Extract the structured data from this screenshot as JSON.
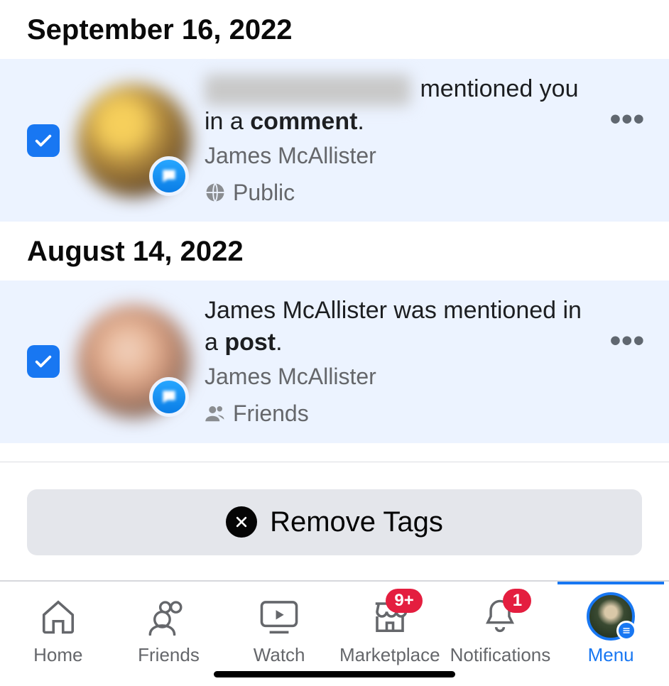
{
  "sections": [
    {
      "date": "September 16, 2022",
      "item": {
        "mentioner_blurred": true,
        "text_part1": " mentioned you in a ",
        "bold_word": "comment",
        "text_part2": ".",
        "sub": "James McAllister",
        "privacy": {
          "icon": "public",
          "label": "Public"
        },
        "checked": true
      }
    },
    {
      "date": "August 14, 2022",
      "item": {
        "mentioner_blurred": false,
        "line": "James McAllister was mentioned in a ",
        "bold_word": "post",
        "text_part2": ".",
        "sub": "James McAllister",
        "privacy": {
          "icon": "friends",
          "label": "Friends"
        },
        "checked": true
      }
    }
  ],
  "remove_tags_label": "Remove Tags",
  "nav": {
    "items": [
      {
        "key": "home",
        "label": "Home"
      },
      {
        "key": "friends",
        "label": "Friends"
      },
      {
        "key": "watch",
        "label": "Watch"
      },
      {
        "key": "marketplace",
        "label": "Marketplace",
        "badge": "9+"
      },
      {
        "key": "notifications",
        "label": "Notifications",
        "badge": "1"
      },
      {
        "key": "menu",
        "label": "Menu",
        "active": true
      }
    ]
  }
}
